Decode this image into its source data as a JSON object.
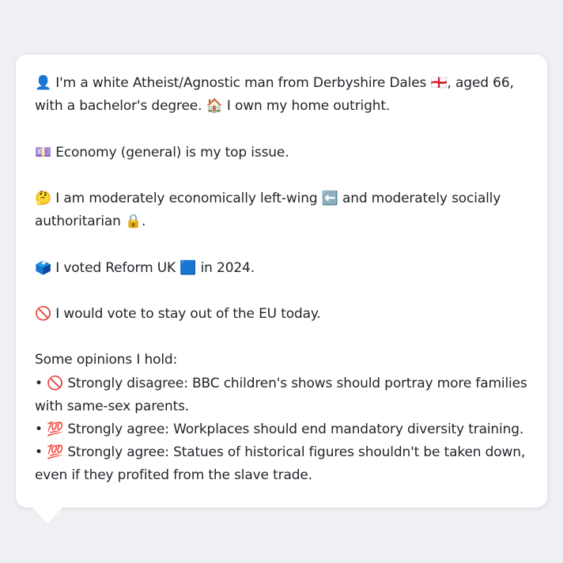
{
  "profile": {
    "line_identity": "👤 I'm a white Atheist/Agnostic man from Derbyshire Dales 🏴󠁧󠁢󠁥󠁮󠁧󠁿, aged 66, with a bachelor's degree. 🏠 I own my home outright.",
    "line_issue": "💷 Economy (general) is my top issue.",
    "line_ideology": "🤔 I am moderately economically left-wing ⬅️ and moderately socially authoritarian 🔒.",
    "line_vote": "🗳️ I voted Reform UK 🟦 in 2024.",
    "line_eu": "🚫 I would vote to stay out of the EU today.",
    "opinions_heading": "Some opinions I hold:",
    "opinions": [
      "• 🚫 Strongly disagree: BBC children's shows should portray more families with same-sex parents.",
      "• 💯 Strongly agree: Workplaces should end mandatory diversity training.",
      "• 💯 Strongly agree: Statues of historical figures shouldn't be taken down, even if they profited from the slave trade."
    ]
  }
}
